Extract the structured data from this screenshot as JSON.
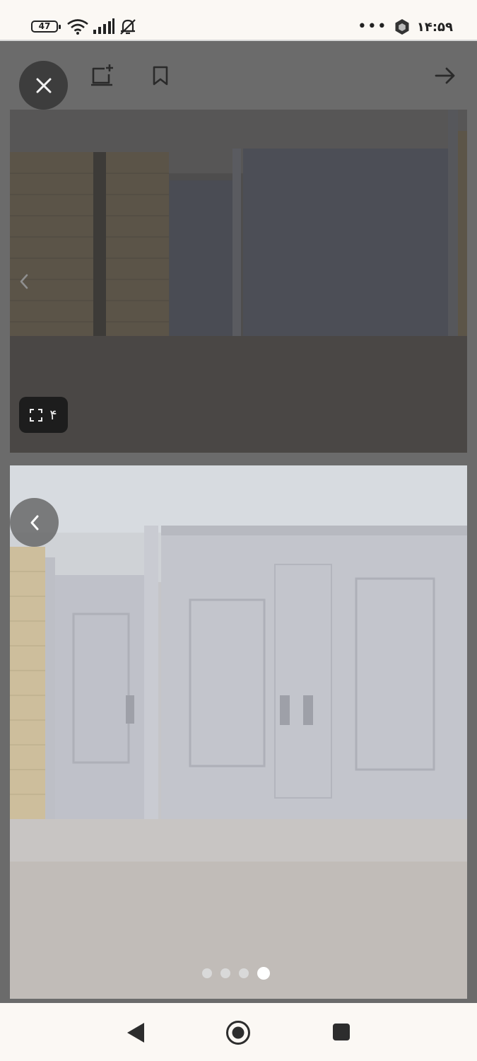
{
  "status_bar": {
    "battery_level": "47",
    "time": "۱۴:۵۹",
    "overflow_dots": "•••",
    "icons": [
      "battery-icon",
      "wifi-icon",
      "signal-icon",
      "mute-bell-icon",
      "app-hexagon-icon"
    ]
  },
  "toolbar": {
    "icons": [
      "close-icon",
      "compare-add-icon",
      "bookmark-icon",
      "arrow-right-icon"
    ]
  },
  "gallery": {
    "photo_count_label": "۴",
    "icons": [
      "expand-icon",
      "chevron-left-icon"
    ],
    "page_indicator": {
      "total": 4,
      "active_index": 3
    }
  },
  "nav_bar": {
    "icons": [
      "back-triangle-icon",
      "home-circle-icon",
      "recents-square-icon"
    ]
  }
}
